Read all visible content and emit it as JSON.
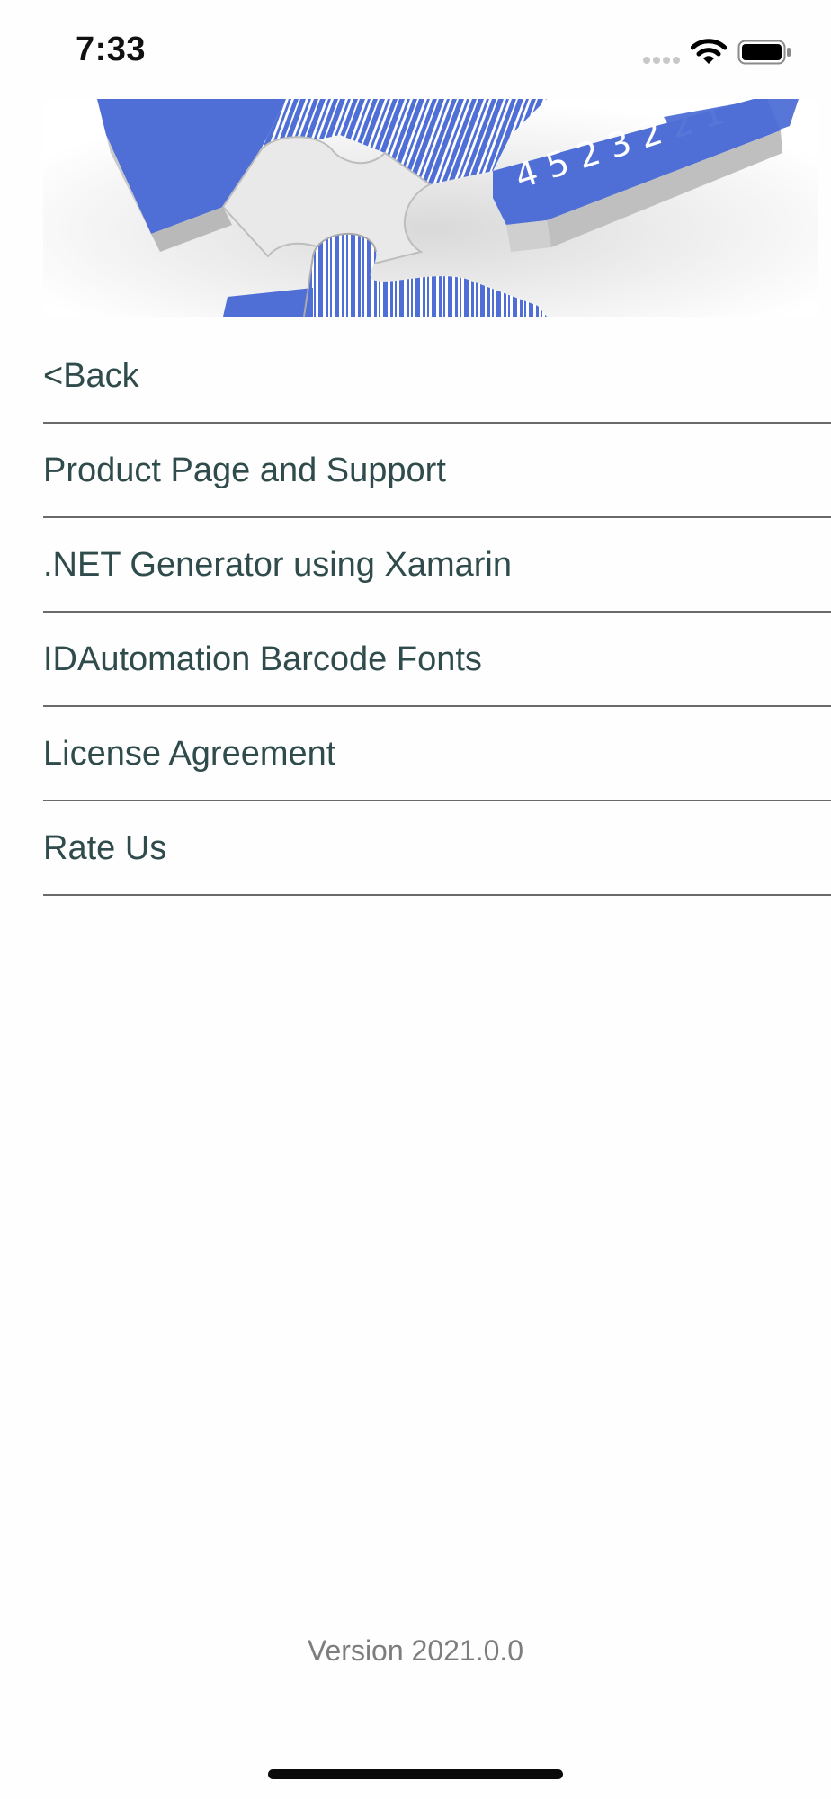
{
  "status_bar": {
    "time": "7:33",
    "icons": [
      "signal-icon",
      "wifi-icon",
      "battery-icon"
    ]
  },
  "banner": {
    "image": "barcode-puzzle-banner",
    "barcode_digits": "4 5 2 3 2 2 1",
    "accent_color": "#4f6fd6"
  },
  "menu": {
    "items": [
      {
        "label": "<Back"
      },
      {
        "label": "Product Page and Support"
      },
      {
        "label": ".NET Generator using Xamarin"
      },
      {
        "label": "IDAutomation Barcode Fonts"
      },
      {
        "label": "License Agreement"
      },
      {
        "label": "Rate Us"
      }
    ]
  },
  "footer": {
    "version": "Version 2021.0.0"
  },
  "colors": {
    "menu_text": "#2f4b4b",
    "divider": "#6a6a6a",
    "version_text": "#7d7d7d",
    "background": "#fefefe"
  }
}
